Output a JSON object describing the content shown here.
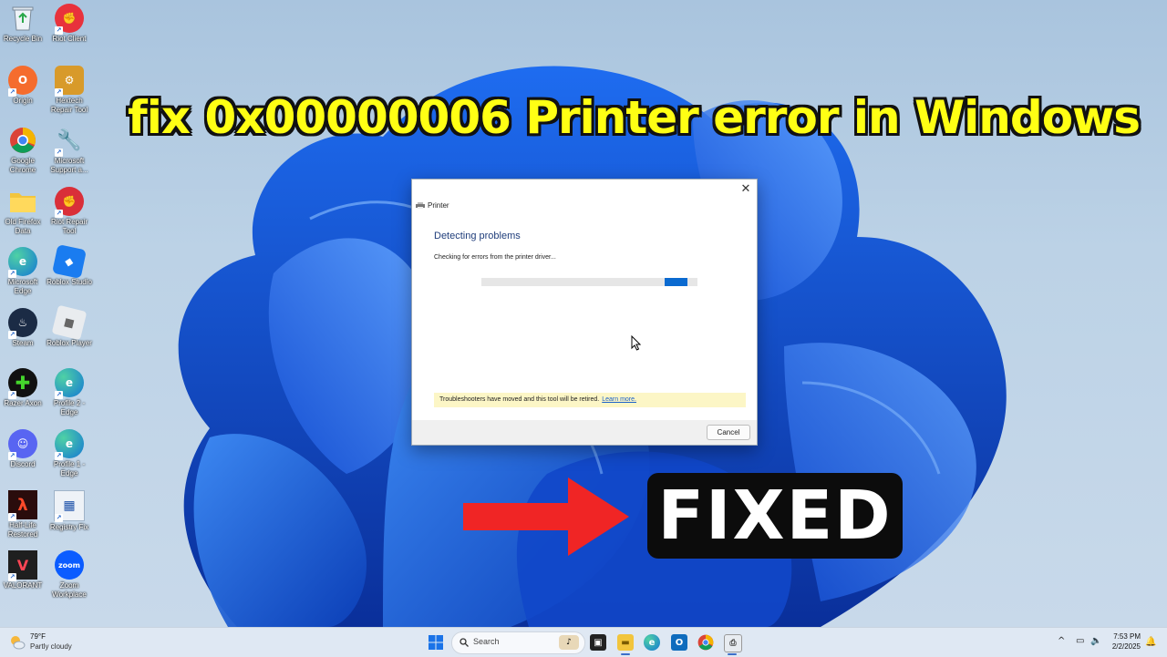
{
  "headline": "fix 0x00000006 Printer error in Windows",
  "desktop_icons": [
    {
      "label": "Recycle Bin",
      "icon": "recycle-bin-icon"
    },
    {
      "label": "Riot Client",
      "icon": "riot-client-icon"
    },
    {
      "label": "Origin",
      "icon": "origin-icon"
    },
    {
      "label": "Hextech Repair Tool",
      "icon": "hextech-icon"
    },
    {
      "label": "Google Chrome",
      "icon": "chrome-icon"
    },
    {
      "label": "Microsoft Support a...",
      "icon": "support-icon"
    },
    {
      "label": "Old Firefox Data",
      "icon": "folder-icon"
    },
    {
      "label": "Riot Repair Tool",
      "icon": "riot-repair-icon"
    },
    {
      "label": "Microsoft Edge",
      "icon": "edge-icon"
    },
    {
      "label": "Roblox Studio",
      "icon": "roblox-studio-icon"
    },
    {
      "label": "Steam",
      "icon": "steam-icon"
    },
    {
      "label": "Roblox Player",
      "icon": "roblox-player-icon"
    },
    {
      "label": "Razer Axon",
      "icon": "razer-icon"
    },
    {
      "label": "Profile 2 - Edge",
      "icon": "edge-profile-icon"
    },
    {
      "label": "Discord",
      "icon": "discord-icon"
    },
    {
      "label": "Profile 1 - Edge",
      "icon": "edge-profile-icon"
    },
    {
      "label": "Half-Life Restored",
      "icon": "halflife-icon"
    },
    {
      "label": "Registry Fix",
      "icon": "registry-icon"
    },
    {
      "label": "VALORANT",
      "icon": "valorant-icon"
    },
    {
      "label": "Zoom Workplace",
      "icon": "zoom-icon"
    }
  ],
  "dialog": {
    "title": "Printer",
    "close_glyph": "✕",
    "heading": "Detecting problems",
    "status": "Checking for errors from the printer driver...",
    "notice": "Troubleshooters have moved and this tool will be retired.",
    "notice_link": "Learn more.",
    "cancel_label": "Cancel"
  },
  "overlay": {
    "fixed_label": "FIXED"
  },
  "taskbar": {
    "temp": "79°F",
    "condition": "Partly cloudy",
    "search_placeholder": "Search",
    "time": "7:53 PM",
    "date": "2/2/2025",
    "tray_chevron": "^",
    "apps": [
      "file-explorer",
      "edge",
      "outlook",
      "chrome",
      "printer-troubleshooter"
    ]
  },
  "colors": {
    "headline": "#ffff14",
    "accent": "#0a6ad0",
    "arrow": "#f02525"
  }
}
